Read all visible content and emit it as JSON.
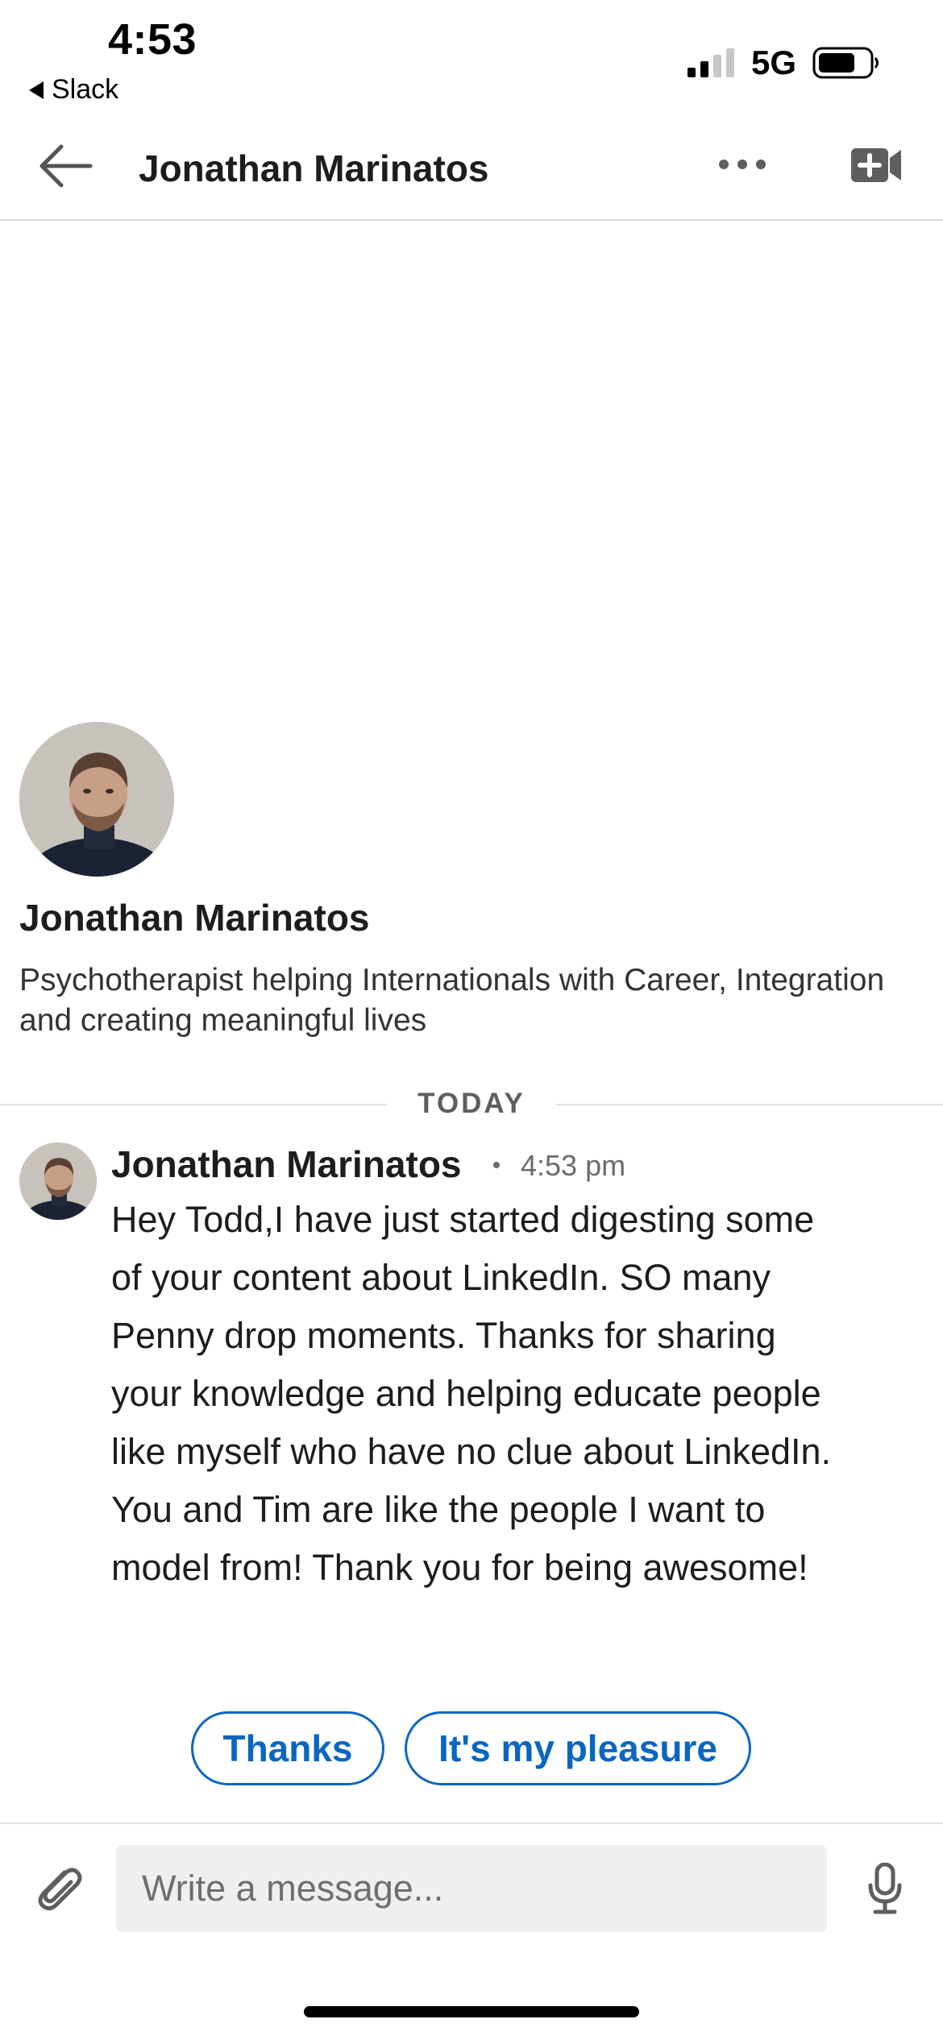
{
  "status_bar": {
    "time": "4:53",
    "back_app": "Slack",
    "network": "5G",
    "icons": [
      "signal-icon",
      "battery-icon"
    ]
  },
  "header": {
    "title": "Jonathan Marinatos",
    "icons": [
      "back-arrow-icon",
      "more-icon",
      "video-call-icon"
    ]
  },
  "profile": {
    "name": "Jonathan Marinatos",
    "headline": "Psychotherapist helping Internationals with Career, Integration and creating meaningful lives"
  },
  "divider": {
    "label": "TODAY"
  },
  "message": {
    "sender": "Jonathan Marinatos",
    "time": "4:53 pm",
    "body": "Hey Todd,I have just started digesting some of your content about LinkedIn. SO many Penny drop moments. Thanks for sharing your knowledge and helping educate people like myself who have no clue about LinkedIn. You and Tim are like the people I want to model from! Thank you for being awesome!"
  },
  "smart_replies": [
    "Thanks",
    "It's my pleasure"
  ],
  "composer": {
    "placeholder": "Write a message...",
    "value": "",
    "icons": [
      "paperclip-icon",
      "microphone-icon"
    ]
  },
  "colors": {
    "accent": "#0a66c2",
    "divider": "#e2e2e2",
    "input_bg": "#efefef"
  }
}
